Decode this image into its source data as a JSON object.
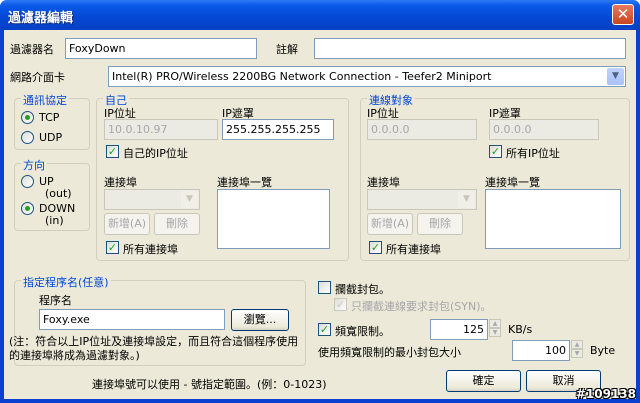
{
  "window": {
    "title": "過濾器編輯",
    "close_glyph": "✕"
  },
  "filter_name": {
    "label": "過濾器名",
    "value": "FoxyDown"
  },
  "comment": {
    "label": "註解",
    "value": ""
  },
  "adapter": {
    "label": "網路介面卡",
    "value": "Intel(R) PRO/Wireless 2200BG Network Connection - Teefer2 Miniport"
  },
  "protocol": {
    "title": "通訊協定",
    "tcp": "TCP",
    "udp": "UDP",
    "selected": "TCP"
  },
  "direction": {
    "title": "方向",
    "up": "UP",
    "up_sub": "(out)",
    "down": "DOWN",
    "down_sub": "(in)",
    "selected": "DOWN"
  },
  "self": {
    "title": "自己",
    "ip_label": "IP位址",
    "ip_value": "10.0.10.97",
    "mask_label": "IP遮罩",
    "mask_value": "255.255.255.255",
    "own_ip_check": "自己的IP位址",
    "own_ip_checked": true,
    "port_label": "連接埠",
    "port_list_label": "連接埠一覽",
    "add_btn": "新增(A)",
    "del_btn": "刪除",
    "all_ports_check": "所有連接埠",
    "all_ports_checked": true
  },
  "remote": {
    "title": "連線對象",
    "ip_label": "IP位址",
    "ip_value": "0.0.0.0",
    "mask_label": "IP遮罩",
    "mask_value": "0.0.0.0",
    "all_ip_check": "所有IP位址",
    "all_ip_checked": true,
    "port_label": "連接埠",
    "port_list_label": "連接埠一覽",
    "add_btn": "新增(A)",
    "del_btn": "刪除",
    "all_ports_check": "所有連接埠",
    "all_ports_checked": true
  },
  "program": {
    "title": "指定程序名(任意)",
    "name_label": "程序名",
    "name_value": "Foxy.exe",
    "browse_btn": "瀏覽...",
    "note": "(注：符合以上IP位址及連接埠設定，而且符合這個程序使用的連接埠將成為過濾對象。)"
  },
  "intercept": {
    "label": "攔截封包。",
    "checked": false,
    "sub_label": "只攔截連線要求封包(SYN)。",
    "sub_checked": true
  },
  "bandwidth": {
    "label": "頻寬限制。",
    "checked": true,
    "value": "125",
    "unit": "KB/s",
    "min_label": "使用頻寬限制的最小封包大小",
    "min_value": "100",
    "min_unit": "Byte"
  },
  "footer": {
    "hint": "連接埠號可以使用 - 號指定範圍。(例：0-1023)",
    "ok": "確定",
    "cancel": "取消"
  },
  "watermark": "#109138"
}
